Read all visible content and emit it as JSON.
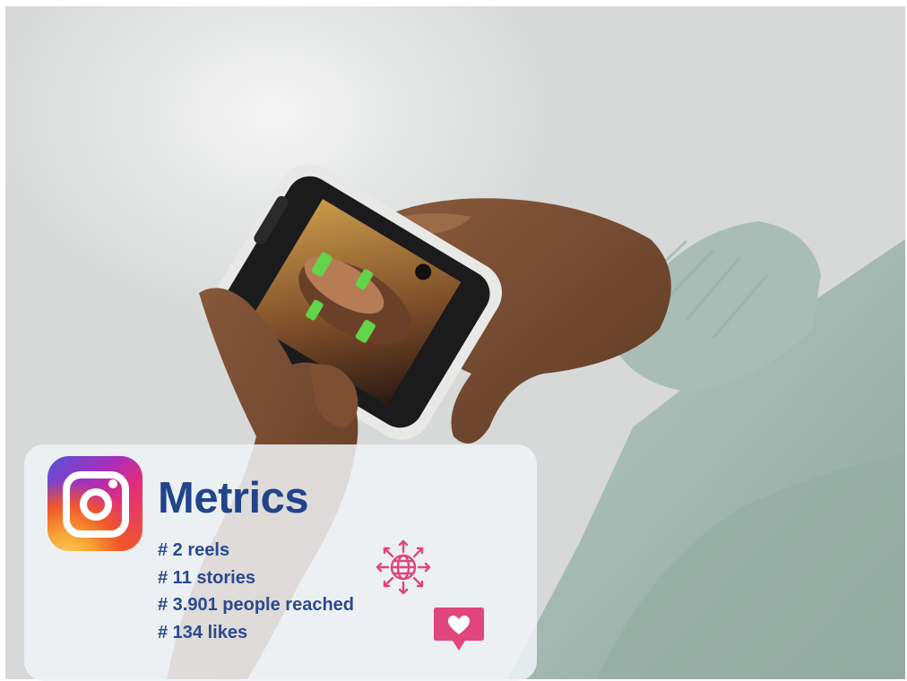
{
  "card": {
    "title": "Metrics",
    "metrics": [
      "# 2 reels",
      "# 11 stories",
      "# 3.901 people reached",
      "# 134 likes"
    ]
  },
  "icons": {
    "logo": "instagram-logo",
    "reach": "globe-arrows-icon",
    "like": "heart-notification-icon"
  },
  "colors": {
    "title": "#21448b",
    "metric_text": "#2a4a8e",
    "accent_pink": "#e0457b",
    "sweater": "#a8bcb5",
    "background": "#e4e7e6"
  }
}
